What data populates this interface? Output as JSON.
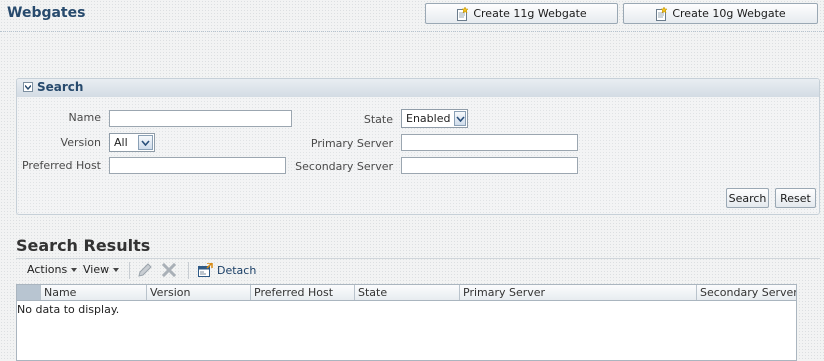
{
  "page": {
    "title": "Webgates",
    "create_11g_label": "Create 11g Webgate",
    "create_10g_label": "Create 10g Webgate"
  },
  "search": {
    "title": "Search",
    "labels": {
      "name": "Name",
      "version": "Version",
      "preferred_host": "Preferred Host",
      "state": "State",
      "primary_server": "Primary Server",
      "secondary_server": "Secondary Server"
    },
    "values": {
      "name": "",
      "version": "All",
      "preferred_host": "",
      "state": "Enabled",
      "primary_server": "",
      "secondary_server": ""
    },
    "search_button": "Search",
    "reset_button": "Reset"
  },
  "results": {
    "title": "Search Results",
    "toolbar": {
      "actions": "Actions",
      "view": "View",
      "detach": "Detach"
    },
    "columns": [
      "Name",
      "Version",
      "Preferred Host",
      "State",
      "Primary Server",
      "Secondary Server"
    ],
    "empty_message": "No data to display."
  },
  "colors": {
    "title_blue": "#274a6d",
    "panel_border": "#c6d0d8"
  },
  "icons": {
    "create": "new-item-icon",
    "edit": "pencil-icon",
    "delete": "delete-x-icon",
    "detach": "detach-icon"
  }
}
